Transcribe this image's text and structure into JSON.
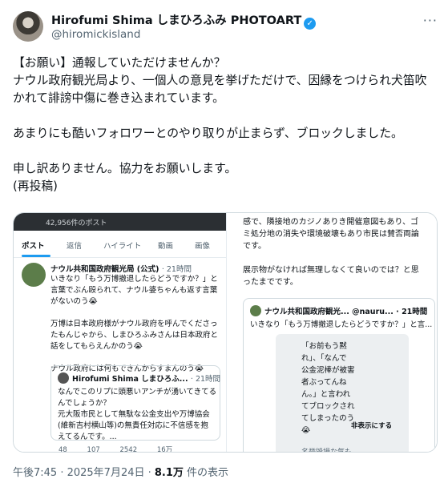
{
  "author": {
    "name": "Hirofumi Shima しまひろふみ PHOTOART",
    "handle": "@hiromickisland",
    "more_glyph": "···"
  },
  "tweet_text": "【お願い】通報していただけませんか？\nナウル政府観光局より、一個人の意見を挙げただけで、因縁をつけられ犬笛吹かれて誹謗中傷に巻き込まれています。\n\nあまりにも酷いフォロワーとのやり取りが止まらず、ブロックしました。\n\n申し訳ありません。協力をお願いします。\n(再投稿)",
  "media": {
    "left": {
      "topbar": "42,956件のポスト",
      "tabs": [
        "ポスト",
        "返信",
        "ハイライト",
        "動画",
        "画像"
      ],
      "post": {
        "name": "ナウル共和国政府観光局 (公式)",
        "time": "· 21時間",
        "text": "いきなり「もう万博撤退したらどうですか？」と\n言葉でぶん殴られて、ナウル婆ちゃんも返す言葉\nがないのう😭\n\n万博は日本政府様がナウル政府を呼んでくださっ\nたもんじゃから、しまひろふみさんは日本政府と\n話をしてもらえんかのう😭\n\nナウル政府には何もできんからすまんのう😭"
      },
      "quote": {
        "name": "Hirofumi Shima しまひろふ...",
        "time": "· 21時間",
        "text": "なんでこのリプに頭悪いアンチが湧いてきてる\nんでしょうか？\n元大阪市民として無駄な公金支出や万博協会\n(維新吉村横山等)の無責任対応に不信感を抱\nえてるんです。..."
      },
      "actions": [
        "48",
        "107",
        "2542",
        "16万"
      ]
    },
    "right": {
      "text": "感で、隣接地のカジノありき開催意図もあり、ゴ\nミ処分地の消失や環境破壊もあり市民は賛否両論\nです。\n\n展示物がなければ無理しなくて良いのでは？と思\nったまでです。",
      "quote_name": "ナウル共和国政府観光... @nauru... · 21時間",
      "quote_text": "いきなり「もう万博撤退したらどうですか？」と言...",
      "card_text": "「お前もう黙\nれ」、「なんで\n公金泥棒が被害\n者ぶってんね\nん。」と言われ\nてブロックされ\nてしまったのう\n😭",
      "hide_label": "非表示にする",
      "card_text2": "名誉毀損な気も"
    }
  },
  "meta": {
    "time": "午後7:45 · 2025年7月24日 · ",
    "views": "8.1万",
    "views_label": " 件の表示"
  }
}
